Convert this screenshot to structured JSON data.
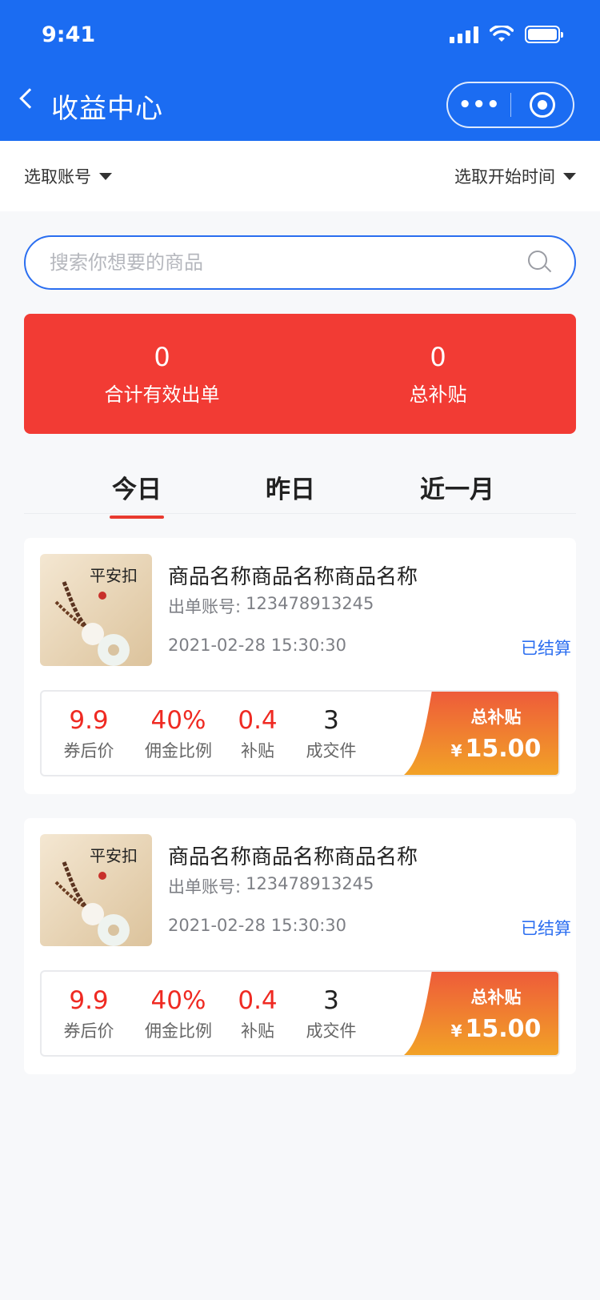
{
  "status_bar": {
    "time": "9:41"
  },
  "nav": {
    "title": "收益中心",
    "more_label": "•••"
  },
  "filters": {
    "account": "选取账号",
    "start_time": "选取开始时间"
  },
  "search": {
    "placeholder": "搜索你想要的商品",
    "value": ""
  },
  "summary": [
    {
      "value": "0",
      "label": "合计有效出单"
    },
    {
      "value": "0",
      "label": "总补贴"
    }
  ],
  "tabs": [
    {
      "label": "今日",
      "active": true
    },
    {
      "label": "昨日",
      "active": false
    },
    {
      "label": "近一月",
      "active": false
    }
  ],
  "colors": {
    "header": "#1b6cf2",
    "stats": "#f23b34",
    "accent_red": "#ef2a22",
    "status_blue": "#2d6ff0",
    "total_gradient": [
      "#ee5a3a",
      "#f2a526"
    ]
  },
  "orders": [
    {
      "name": "商品名称商品名称商品名称",
      "account_label": "出单账号:",
      "account": "123478913245",
      "datetime": "2021-02-28 15:30:30",
      "status": "已结算",
      "image_text": "平安扣",
      "metrics": [
        {
          "value": "9.9",
          "label": "券后价"
        },
        {
          "value": "40%",
          "label": "佣金比例"
        },
        {
          "value": "0.4",
          "label": "补贴"
        },
        {
          "value": "3",
          "label": "成交件"
        }
      ],
      "total_label": "总补贴",
      "currency": "¥",
      "total_amount": "15.00"
    },
    {
      "name": "商品名称商品名称商品名称",
      "account_label": "出单账号:",
      "account": "123478913245",
      "datetime": "2021-02-28 15:30:30",
      "status": "已结算",
      "image_text": "平安扣",
      "metrics": [
        {
          "value": "9.9",
          "label": "券后价"
        },
        {
          "value": "40%",
          "label": "佣金比例"
        },
        {
          "value": "0.4",
          "label": "补贴"
        },
        {
          "value": "3",
          "label": "成交件"
        }
      ],
      "total_label": "总补贴",
      "currency": "¥",
      "total_amount": "15.00"
    }
  ]
}
